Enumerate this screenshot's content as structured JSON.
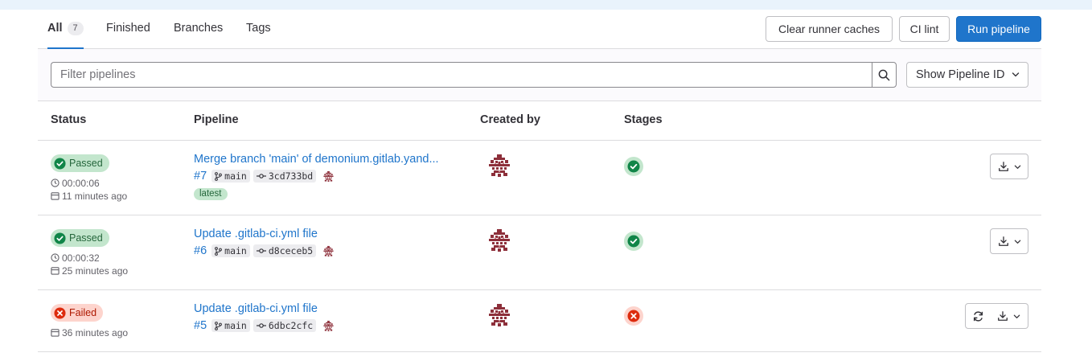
{
  "tabs": [
    {
      "label": "All",
      "count": "7"
    },
    {
      "label": "Finished"
    },
    {
      "label": "Branches"
    },
    {
      "label": "Tags"
    }
  ],
  "actions": {
    "clear_caches": "Clear runner caches",
    "ci_lint": "CI lint",
    "run_pipeline": "Run pipeline"
  },
  "filter": {
    "placeholder": "Filter pipelines",
    "show_id_label": "Show Pipeline ID"
  },
  "columns": {
    "status": "Status",
    "pipeline": "Pipeline",
    "created_by": "Created by",
    "stages": "Stages"
  },
  "pipelines": [
    {
      "status": "Passed",
      "duration": "00:00:06",
      "finished": "11 minutes ago",
      "title": "Merge branch 'main' of demonium.gitlab.yand...",
      "id": "#7",
      "branch": "main",
      "commit": "3cd733bd",
      "tag": "latest"
    },
    {
      "status": "Passed",
      "duration": "00:00:32",
      "finished": "25 minutes ago",
      "title": "Update .gitlab-ci.yml file",
      "id": "#6",
      "branch": "main",
      "commit": "d8ceceb5"
    },
    {
      "status": "Failed",
      "finished": "36 minutes ago",
      "title": "Update .gitlab-ci.yml file",
      "id": "#5",
      "branch": "main",
      "commit": "6dbc2cfc"
    }
  ],
  "colors": {
    "accent": "#1f75cb",
    "success": "#108548",
    "danger": "#dd2b0e"
  },
  "icons": {
    "search": "search-icon",
    "chevron": "chevron-down-icon",
    "clock": "clock-icon",
    "calendar": "calendar-icon",
    "branch": "branch-icon",
    "commit": "commit-icon",
    "download": "download-icon",
    "retry": "retry-icon"
  }
}
